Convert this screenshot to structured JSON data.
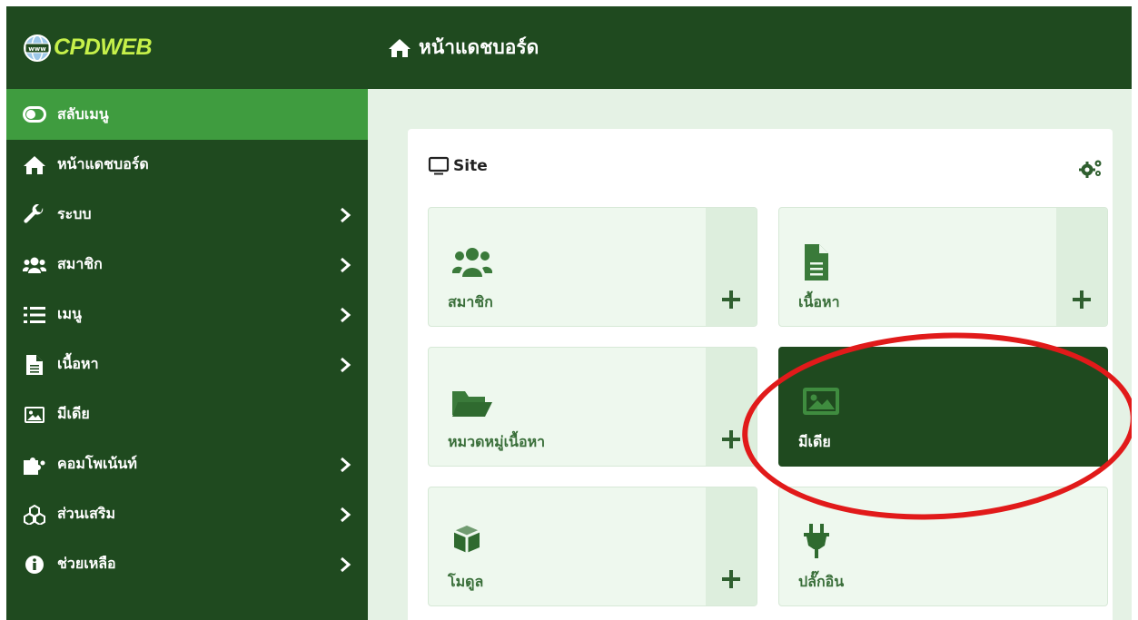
{
  "brand": {
    "name": "CPDWEB",
    "globe_label": "www"
  },
  "header": {
    "title": "หน้าแดชบอร์ด"
  },
  "sidebar": {
    "items": [
      {
        "label": "สลับเมนู",
        "icon": "toggle-icon",
        "has_submenu": false
      },
      {
        "label": "หน้าแดชบอร์ด",
        "icon": "home-icon",
        "has_submenu": false
      },
      {
        "label": "ระบบ",
        "icon": "wrench-icon",
        "has_submenu": true
      },
      {
        "label": "สมาชิก",
        "icon": "users-icon",
        "has_submenu": true
      },
      {
        "label": "เมนู",
        "icon": "list-icon",
        "has_submenu": true
      },
      {
        "label": "เนื้อหา",
        "icon": "file-icon",
        "has_submenu": true
      },
      {
        "label": "มีเดีย",
        "icon": "image-icon",
        "has_submenu": false
      },
      {
        "label": "คอมโพเน้นท์",
        "icon": "puzzle-icon",
        "has_submenu": true
      },
      {
        "label": "ส่วนเสริม",
        "icon": "cubes-icon",
        "has_submenu": true
      },
      {
        "label": "ช่วยเหลือ",
        "icon": "info-icon",
        "has_submenu": true
      }
    ]
  },
  "site": {
    "title": "Site",
    "tiles": [
      {
        "label": "สมาชิก",
        "icon": "users-icon",
        "add": "+"
      },
      {
        "label": "เนื้อหา",
        "icon": "file-icon",
        "add": "+"
      },
      {
        "label": "หมวดหมู่เนื้อหา",
        "icon": "folder-open-icon",
        "add": "+"
      },
      {
        "label": "มีเดีย",
        "icon": "image-icon",
        "active": true
      },
      {
        "label": "โมดูล",
        "icon": "cube-icon",
        "add": "+"
      },
      {
        "label": "ปลั๊กอิน",
        "icon": "plug-icon"
      }
    ]
  },
  "colors": {
    "dark_green": "#1f4a1f",
    "menu_active": "#3f9c3f",
    "content_bg": "#e5f2e5",
    "tile_bg": "#eef8ee",
    "tile_text": "#3a6f3a",
    "highlight_red": "#e11a1a",
    "brand_text": "#c6f04a"
  }
}
